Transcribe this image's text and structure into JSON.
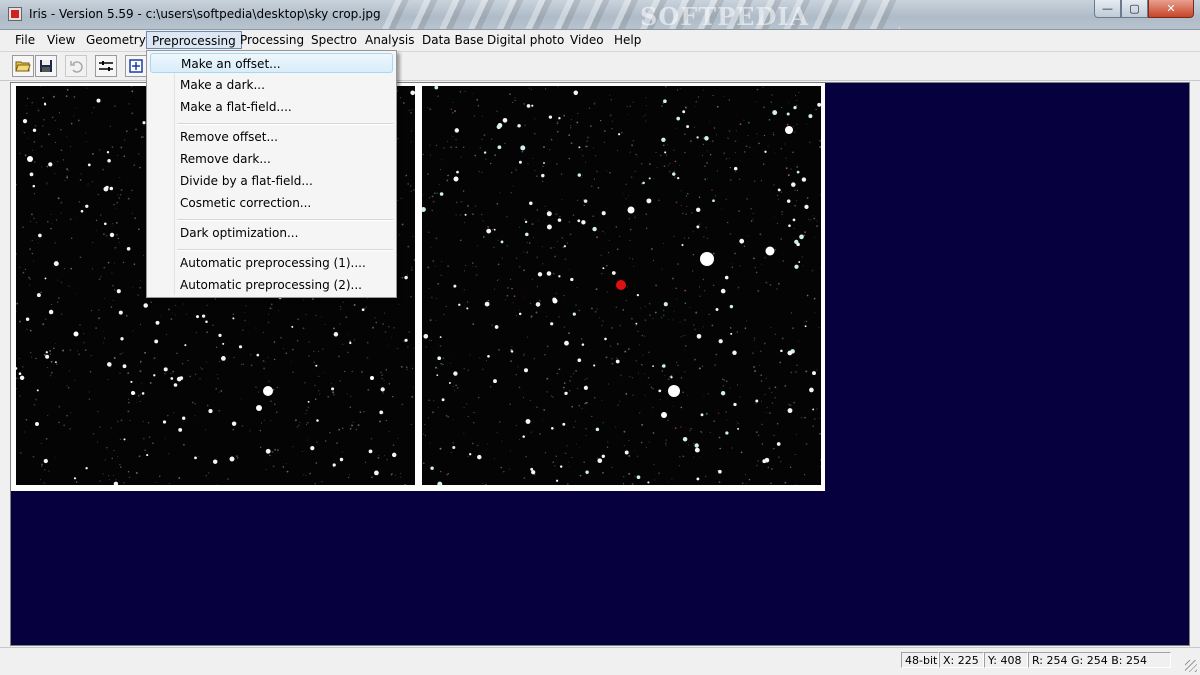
{
  "window": {
    "title": "Iris - Version 5.59 - c:\\users\\softpedia\\desktop\\sky crop.jpg",
    "brand_watermark": "SOFTPEDIA",
    "controls": {
      "minimize": "—",
      "maximize": "▢",
      "close": "✕"
    }
  },
  "menubar": {
    "items": [
      {
        "label": "File"
      },
      {
        "label": "View"
      },
      {
        "label": "Geometry"
      },
      {
        "label": "Preprocessing"
      },
      {
        "label": "Processing"
      },
      {
        "label": "Spectro"
      },
      {
        "label": "Analysis"
      },
      {
        "label": "Data Base"
      },
      {
        "label": "Digital photo"
      },
      {
        "label": "Video"
      },
      {
        "label": "Help"
      }
    ],
    "active": "Preprocessing"
  },
  "toolbar": {
    "buttons": [
      {
        "icon": "open-folder-icon"
      },
      {
        "icon": "save-disk-icon"
      },
      {
        "icon": "undo-icon"
      },
      {
        "icon": "settings-sliders-icon"
      },
      {
        "icon": "zoom-icon"
      }
    ]
  },
  "preprocessing_menu": {
    "groups": [
      [
        "Make an offset...",
        "Make a dark...",
        "Make a flat-field...."
      ],
      [
        "Remove offset...",
        "Remove dark...",
        "Divide by a flat-field...",
        "Cosmetic correction..."
      ],
      [
        "Dark optimization..."
      ],
      [
        "Automatic preprocessing (1)....",
        "Automatic preprocessing (2)..."
      ]
    ],
    "highlighted": "Make an offset..."
  },
  "statusbar": {
    "bits": "48-bits",
    "x": "X: 225",
    "y": "Y: 408",
    "rgb": "R: 254  G: 254  B: 254"
  },
  "colors": {
    "workspace": "#07003f",
    "highlight_star": "#e01010"
  }
}
